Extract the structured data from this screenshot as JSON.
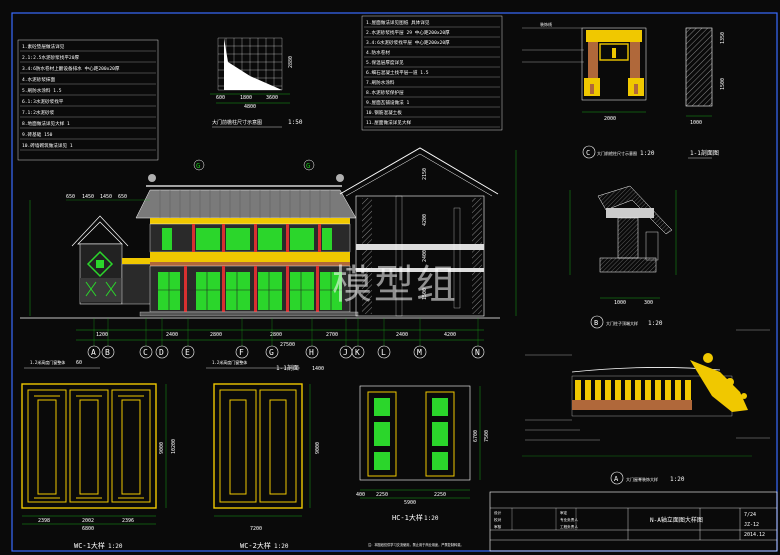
{
  "watermark": "模型组",
  "colors": {
    "frame": "#3a6cff",
    "line": "#ffffff",
    "dim": "#19c819",
    "accent": "#f0c800",
    "glass": "#2bd62b",
    "roof": "#7a7a7a",
    "brown": "#b0683a",
    "red": "#d83030"
  },
  "notes_left": [
    "1.素砼垫层做法详见",
    "2.1:2.5水泥砂浆找平20厚",
    "3.4:6防水卷材上翻设备排水  中心距200x20厚",
    "4.水泥砂浆抹面",
    "5.刷防水涂料    1.5",
    "6.1:3水泥砂浆找平",
    "7.1:2水泥砂浆",
    "8.地面做法详见大样    1",
    "9.砖基础      150",
    "10.砖墙砌筑做法详见   1"
  ],
  "notes_mid": [
    "1.屋面做法详见图纸  具体详见",
    "2.水泥砂浆找平层    29  中心距200x20厚",
    "3.4:6水泥砂浆找平层 中心距200x20厚",
    "4.防水卷材",
    "5.保温层厚度详见",
    "6.细石混凝土找平层一道  1.5",
    "7.刷防水涂料",
    "8.水泥砂浆保护层",
    "9.屋面瓦铺设做法      1",
    "10.钢筋混凝土板",
    "11.屋面做法详见大样"
  ],
  "drawing_titles": {
    "cornice_section": "大门前檐柱尺寸示意图",
    "section_1_1": "1-1剖面图",
    "detail_b": "大门柱子顶端大样",
    "detail_a": "大门屋脊装饰大样",
    "wc1": "WC-1大样",
    "wc2": "WC-2大样",
    "hc1": "HC-1大样",
    "main_elev": "N-A轴立面图",
    "door_section": "1-1剖面"
  },
  "scales": {
    "s1": "1:50",
    "s2": "1:20",
    "s3": "1:20",
    "s4": "1:20",
    "s5": "1:20",
    "s6": "1:20",
    "s7": "1:20",
    "s8": "1:100"
  },
  "dims": {
    "graph_w": "4800",
    "graph_a": "600",
    "graph_b": "1800",
    "graph_c": "3600",
    "graph_h": "2880",
    "cornice_w": "2000",
    "cornice_h1": "1350",
    "cornice_h2": "1500",
    "column_w": "1000",
    "db_w": "1000",
    "db_w2": "300",
    "wc1_w": "2398",
    "wc1_w2": "2002",
    "wc1_w3": "2396",
    "wc1_total": "6800",
    "wc1_h": "9000",
    "wc1_h2": "10200",
    "wc2_w": "7200",
    "wc2_h": "9000",
    "hc1_a": "2250",
    "hc1_b": "2250",
    "hc1_c": "400",
    "hc1_total": "5900",
    "hc1_h": "6700",
    "hc1_h2": "7500",
    "e_a": "1200",
    "e_b": "2400",
    "e_c": "2800",
    "e_d": "2800",
    "e_e": "2700",
    "e_f": "2400",
    "e_g": "4200",
    "e_total": "27500",
    "s_a": "2150",
    "s_b": "4200",
    "s_c": "2400",
    "s_d": "1500",
    "top_a": "650",
    "top_b": "1450",
    "top_c": "1450",
    "top_d": "650"
  },
  "axes": [
    "A",
    "B",
    "C",
    "D",
    "E",
    "F",
    "G",
    "H",
    "J",
    "K",
    "L",
    "M",
    "N"
  ],
  "axis_markers_top": [
    "G",
    "G"
  ],
  "title_block": {
    "title": "N-A轴立面图大样图",
    "rows": [
      "设计",
      "校对",
      "审核",
      "审定",
      "专业负责人",
      "工程负责人"
    ],
    "codes": [
      "7/24",
      "JZ-12",
      "2014.12"
    ],
    "footer": "注：本图纸仅供学习交流使用，禁止用于商业用途，严禁复制转载。"
  },
  "wc_label_1": "1.2米高度门窗整体",
  "wc_label_2": "1.2米高度门窗整体",
  "value_60": "60",
  "value_1400": "1400"
}
